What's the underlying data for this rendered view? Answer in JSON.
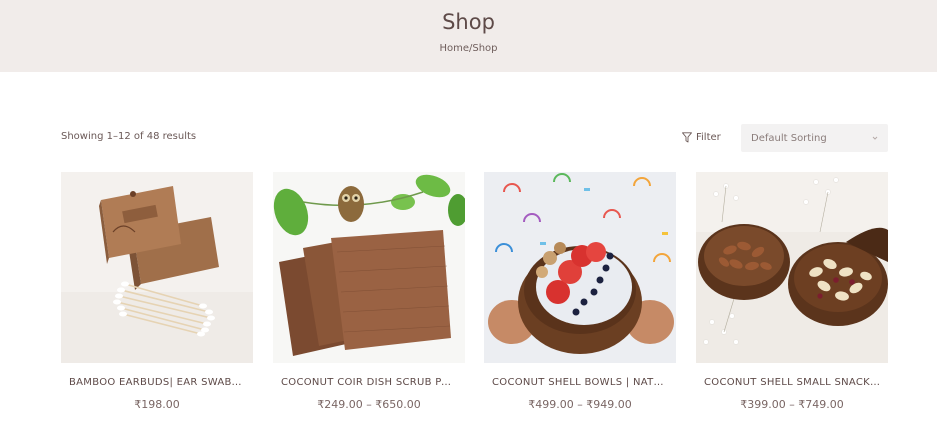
{
  "header": {
    "title": "Shop",
    "breadcrumb": {
      "home": "Home",
      "separator": "/",
      "current": "Shop"
    }
  },
  "toolbar": {
    "results_text": "Showing 1–12 of 48 results",
    "filter_label": "Filter",
    "filter_icon": "filter-funnel-icon",
    "sort_selected": "Default Sorting",
    "sort_icon": "chevron-down-icon"
  },
  "products": [
    {
      "name": "BAMBOO EARBUDS| EAR SWABS –...",
      "price": "₹198.00"
    },
    {
      "name": "COCONUT COIR DISH SCRUB PADS",
      "price": "₹249.00 – ₹650.00"
    },
    {
      "name": "COCONUT SHELL BOWLS | NATURAL...",
      "price": "₹499.00 – ₹949.00"
    },
    {
      "name": "COCONUT SHELL SMALL SNACK...",
      "price": "₹399.00 – ₹749.00"
    }
  ],
  "colors": {
    "header_bg": "#f1ecea",
    "text_primary": "#5e4a48",
    "select_bg": "#f3f2f2"
  }
}
